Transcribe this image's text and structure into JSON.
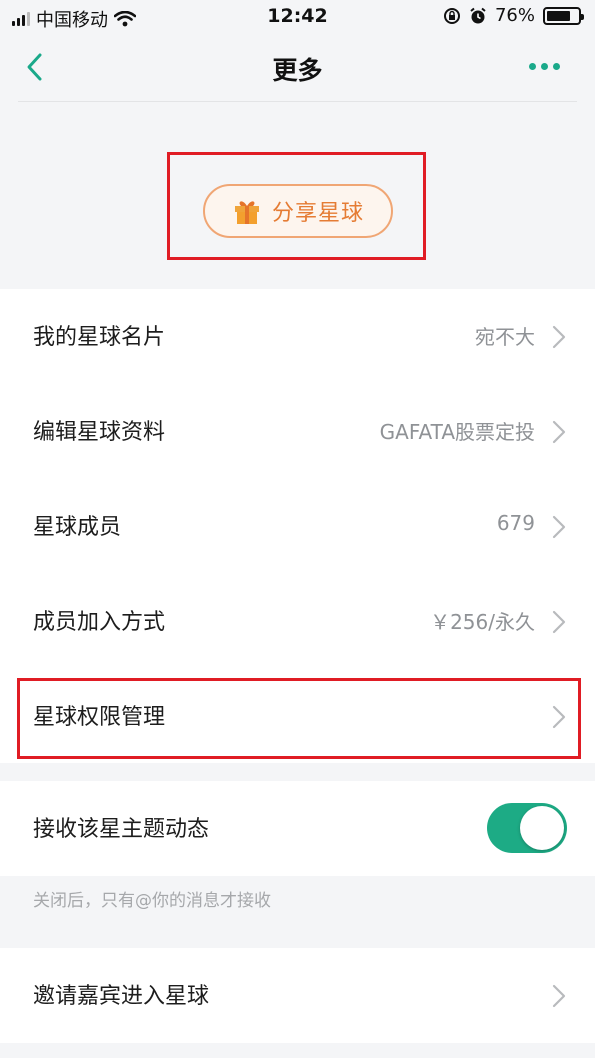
{
  "status_bar": {
    "carrier": "中国移动",
    "time": "12:42",
    "battery": "76%",
    "battery_level": 0.76
  },
  "nav": {
    "title": "更多",
    "back_icon": "chevron-left-icon",
    "more_icon": "more-dots-icon"
  },
  "share": {
    "label": "分享星球",
    "icon": "gift-icon"
  },
  "menu": {
    "items": [
      {
        "label": "我的星球名片",
        "value": "宛不大"
      },
      {
        "label": "编辑星球资料",
        "value": "GAFATA股票定投"
      },
      {
        "label": "星球成员",
        "value": "679"
      },
      {
        "label": "成员加入方式",
        "value": "￥256/永久"
      },
      {
        "label": "星球权限管理",
        "value": ""
      }
    ]
  },
  "subscribe": {
    "label": "接收该星主题动态",
    "enabled": true,
    "hint": "关闭后，只有@你的消息才接收"
  },
  "invite": {
    "label": "邀请嘉宾进入星球"
  },
  "colors": {
    "accent": "#1dab85",
    "share_orange": "#e57c34",
    "highlight_red": "#e01c24"
  }
}
